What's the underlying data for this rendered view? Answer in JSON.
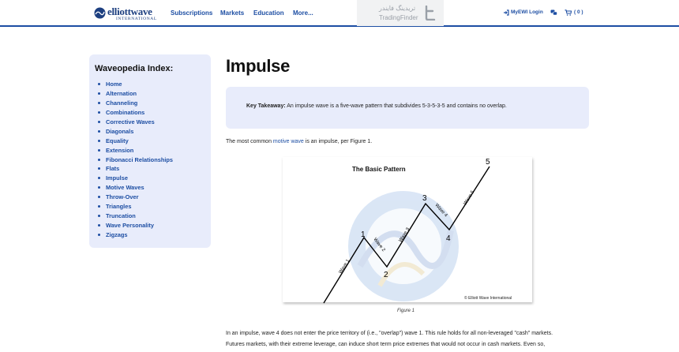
{
  "header": {
    "logo_word": "elliottwave",
    "logo_sub": "INTERNATIONAL",
    "nav": [
      "Subscriptions",
      "Markets",
      "Education",
      "More..."
    ],
    "login_label": "MyEWI Login",
    "cart_label": "( 0 )"
  },
  "watermark": {
    "persian": "تریدینگ فایندر",
    "english": "TradingFinder"
  },
  "sidebar": {
    "title": "Waveopedia Index:",
    "items": [
      "Home",
      "Alternation",
      "Channeling",
      "Combinations",
      "Corrective Waves",
      "Diagonals",
      "Equality",
      "Extension",
      "Fibonacci Relationships",
      "Flats",
      "Impulse",
      "Motive Waves",
      "Throw-Over",
      "Triangles",
      "Truncation",
      "Wave Personality",
      "Zigzags"
    ]
  },
  "main": {
    "title": "Impulse",
    "key_takeaway_label": "Key Takeaway:",
    "key_takeaway_text": " An impulse wave is a five-wave pattern that subdivides 5-3-5-3-5 and contains no overlap.",
    "para1_before": "The most common ",
    "para1_link": "motive wave",
    "para1_after": " is an impulse, per Figure 1.",
    "figure": {
      "title": "The Basic Pattern",
      "copyright": "© Elliott Wave International",
      "caption": "Figure 1",
      "points": [
        "1",
        "2",
        "3",
        "4",
        "5"
      ],
      "wave_labels": [
        "Wave 1",
        "Wave 2",
        "Wave 3",
        "Wave 4",
        "Wave 5"
      ]
    },
    "para2": "In an impulse, wave 4 does not enter the price territory of (i.e., \"overlap\") wave 1. This rule holds for all non-leveraged \"cash\" markets.",
    "para3": "Futures markets, with their extreme leverage, can induce short term price extremes that would not occur in cash markets. Even so,"
  }
}
